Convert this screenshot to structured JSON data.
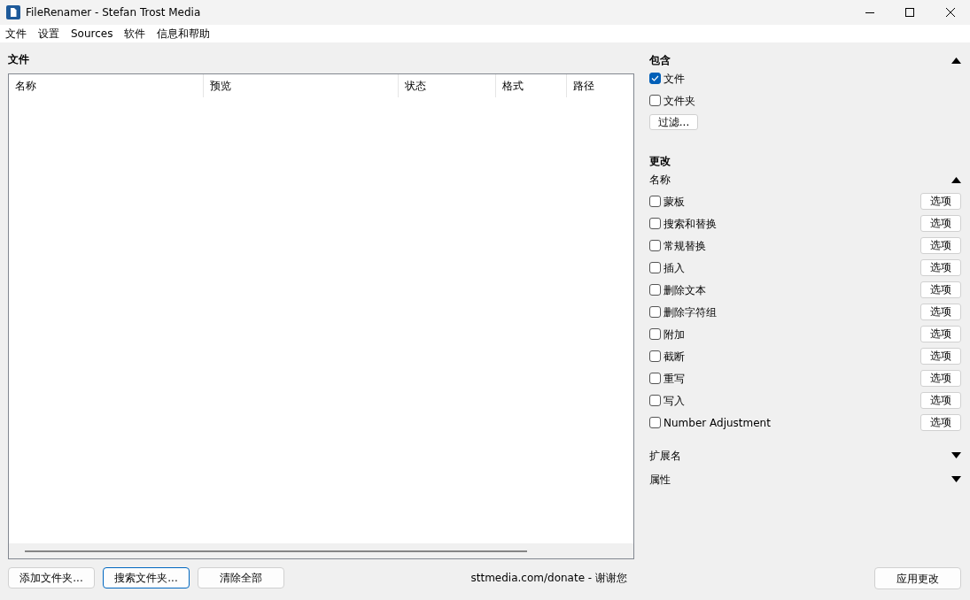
{
  "window": {
    "title": "FileRenamer - Stefan Trost Media"
  },
  "menu": [
    "文件",
    "设置",
    "Sources",
    "软件",
    "信息和帮助"
  ],
  "files": {
    "title": "文件",
    "columns": [
      "名称",
      "预览",
      "状态",
      "格式",
      "路径"
    ]
  },
  "buttons": [
    {
      "label": "添加文件夹...",
      "selected": false
    },
    {
      "label": "搜索文件夹...",
      "selected": true
    },
    {
      "label": "清除全部",
      "selected": false
    }
  ],
  "donate": "sttmedia.com/donate - 谢谢您",
  "include": {
    "title": "包含",
    "expanded": true,
    "options": [
      {
        "label": "文件",
        "checked": true
      },
      {
        "label": "文件夹",
        "checked": false
      }
    ],
    "filter_button": "过滤..."
  },
  "change": {
    "title": "更改",
    "name_section": {
      "title": "名称",
      "expanded": true
    },
    "items": [
      {
        "label": "蒙板",
        "checked": false,
        "button": "选项"
      },
      {
        "label": "搜索和替换",
        "checked": false,
        "button": "选项"
      },
      {
        "label": "常规替换",
        "checked": false,
        "button": "选项"
      },
      {
        "label": "插入",
        "checked": false,
        "button": "选项"
      },
      {
        "label": "删除文本",
        "checked": false,
        "button": "选项"
      },
      {
        "label": "删除字符组",
        "checked": false,
        "button": "选项"
      },
      {
        "label": "附加",
        "checked": false,
        "button": "选项"
      },
      {
        "label": "截断",
        "checked": false,
        "button": "选项"
      },
      {
        "label": "重写",
        "checked": false,
        "button": "选项"
      },
      {
        "label": "写入",
        "checked": false,
        "button": "选项"
      },
      {
        "label": "Number Adjustment",
        "checked": false,
        "button": "选项"
      }
    ],
    "sections": [
      {
        "title": "扩展名",
        "expanded": false
      },
      {
        "title": "属性",
        "expanded": false
      }
    ]
  },
  "apply_button": "应用更改"
}
